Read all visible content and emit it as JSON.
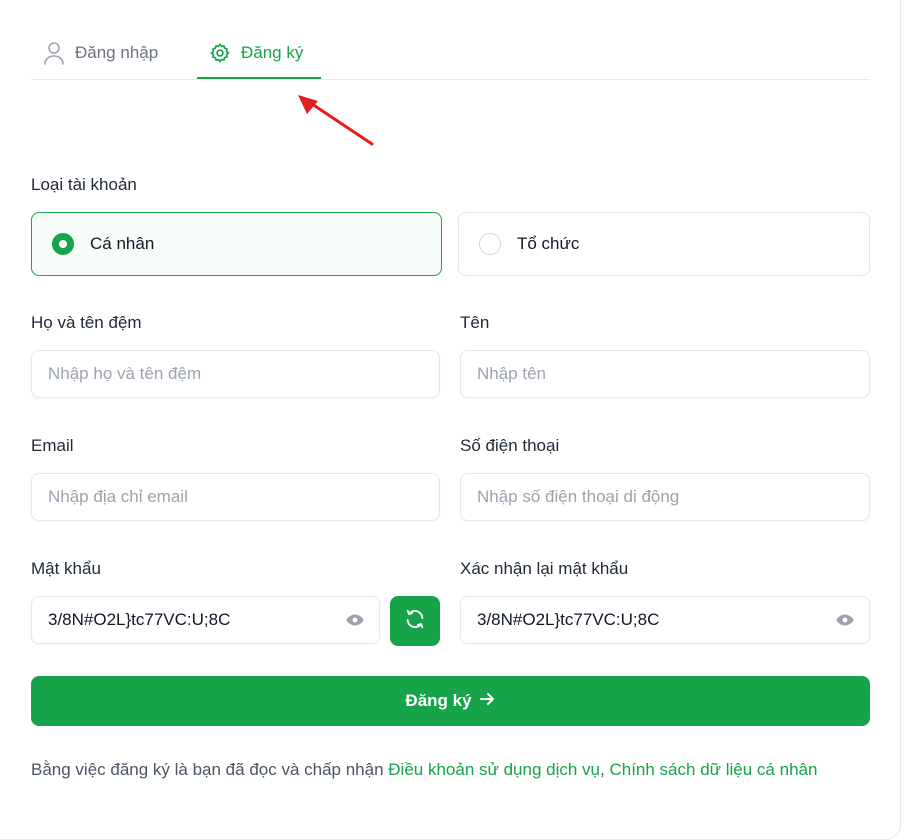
{
  "tabs": {
    "login": "Đăng nhập",
    "register": "Đăng ký"
  },
  "account_type": {
    "label": "Loại tài khoản",
    "options": [
      "Cá nhân",
      "Tổ chức"
    ],
    "selected": "Cá nhân"
  },
  "fields": {
    "last_name": {
      "label": "Họ và tên đệm",
      "placeholder": "Nhập họ và tên đệm"
    },
    "first_name": {
      "label": "Tên",
      "placeholder": "Nhập tên"
    },
    "email": {
      "label": "Email",
      "placeholder": "Nhập địa chỉ email"
    },
    "phone": {
      "label": "Số điện thoại",
      "placeholder": "Nhập số điện thoại di động"
    },
    "password": {
      "label": "Mật khẩu",
      "value": "3/8N#O2L}tc77VC:U;8C"
    },
    "confirm_password": {
      "label": "Xác nhận lại mật khẩu",
      "value": "3/8N#O2L}tc77VC:U;8C"
    }
  },
  "submit": {
    "label": "Đăng ký",
    "icon": "arrow-right-icon"
  },
  "terms": {
    "prefix": "Bằng việc đăng ký là bạn đã đọc và chấp nhận ",
    "link1": "Điều khoản sử dụng dịch vụ",
    "separator": ", ",
    "link2": "Chính sách dữ liệu cá nhân"
  },
  "colors": {
    "accent": "#16a34a",
    "annotation_arrow": "#e11d1d"
  },
  "icons": [
    "user-icon",
    "gear-icon",
    "eye-icon",
    "refresh-icon",
    "arrow-right-icon"
  ]
}
